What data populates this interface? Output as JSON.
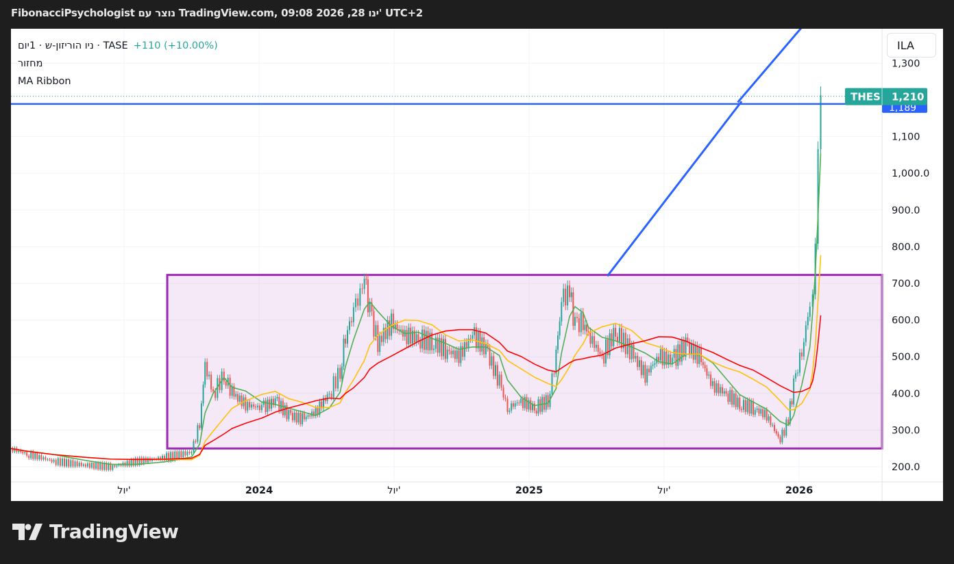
{
  "header": {
    "title": "FibonacciPsychologist נוצר עם TradingView.com, 09:08 2026 ,28 ינו' UTC+2"
  },
  "legend": {
    "symbol": "ניו הוריזון-ש · 1יום · TASE",
    "change": "+110 (+10.00%)",
    "indicator1": "מחזור",
    "indicator2": "MA Ribbon"
  },
  "currency": "ILA",
  "logo": "TradingView",
  "colors": {
    "up": "#26a69a",
    "down": "#ef5350",
    "ma_fast": "#4caf50",
    "ma_mid": "#ffc107",
    "ma_slow": "#f00",
    "box": "#9c27b0",
    "trend": "#2962ff"
  },
  "chart_data": {
    "type": "candlestick",
    "symbol": "THES",
    "last_price_label": "THES",
    "last_price": "1,210",
    "hline_label": "1,189",
    "hline_value": 1189,
    "y_ticks": [
      "1,300",
      "1,100",
      "1,000.0",
      "900.0",
      "800.0",
      "700.0",
      "600.0",
      "500.0",
      "400.0",
      "300.0",
      "200.0"
    ],
    "y_tick_values": [
      1300,
      1100,
      1000,
      900,
      800,
      700,
      600,
      500,
      400,
      300,
      200
    ],
    "x_ticks": [
      {
        "label": "יול'",
        "t": 2023.5
      },
      {
        "label": "2024",
        "t": 2024.0
      },
      {
        "label": "יול'",
        "t": 2024.5
      },
      {
        "label": "2025",
        "t": 2025.0
      },
      {
        "label": "יול'",
        "t": 2025.5
      },
      {
        "label": "2026",
        "t": 2026.0
      }
    ],
    "x_range": [
      2023.04,
      2026.3
    ],
    "y_range": [
      180,
      1420
    ],
    "range_box": {
      "t_start": 2023.66,
      "low": 250,
      "high": 723
    },
    "trend_line": {
      "t0": 2025.29,
      "p0": 720,
      "t1": 2026.0,
      "p1": 1400
    },
    "t": [
      2023.08,
      2023.14,
      2023.24,
      2023.35,
      2023.45,
      2023.55,
      2023.65,
      2023.75,
      2023.78,
      2023.8,
      2023.83,
      2023.87,
      2023.9,
      2023.95,
      2024.01,
      2024.06,
      2024.11,
      2024.16,
      2024.21,
      2024.26,
      2024.3,
      2024.32,
      2024.35,
      2024.39,
      2024.41,
      2024.44,
      2024.49,
      2024.54,
      2024.59,
      2024.64,
      2024.69,
      2024.74,
      2024.79,
      2024.84,
      2024.89,
      2024.92,
      2024.97,
      2025.02,
      2025.07,
      2025.1,
      2025.12,
      2025.15,
      2025.17,
      2025.2,
      2025.22,
      2025.27,
      2025.32,
      2025.38,
      2025.43,
      2025.48,
      2025.53,
      2025.58,
      2025.63,
      2025.68,
      2025.73,
      2025.78,
      2025.83,
      2025.88,
      2025.93,
      2025.96,
      2025.98,
      2026.01,
      2026.04,
      2026.05,
      2026.06,
      2026.07,
      2026.08
    ],
    "close": [
      250,
      235,
      215,
      205,
      200,
      215,
      225,
      240,
      320,
      480,
      400,
      450,
      400,
      370,
      360,
      380,
      340,
      330,
      350,
      400,
      460,
      560,
      620,
      710,
      620,
      540,
      590,
      560,
      550,
      540,
      520,
      500,
      560,
      520,
      430,
      360,
      380,
      360,
      380,
      500,
      650,
      680,
      580,
      600,
      560,
      500,
      570,
      510,
      450,
      500,
      490,
      530,
      500,
      420,
      400,
      370,
      360,
      340,
      270,
      330,
      420,
      520,
      640,
      700,
      850,
      1100,
      1210
    ]
  }
}
